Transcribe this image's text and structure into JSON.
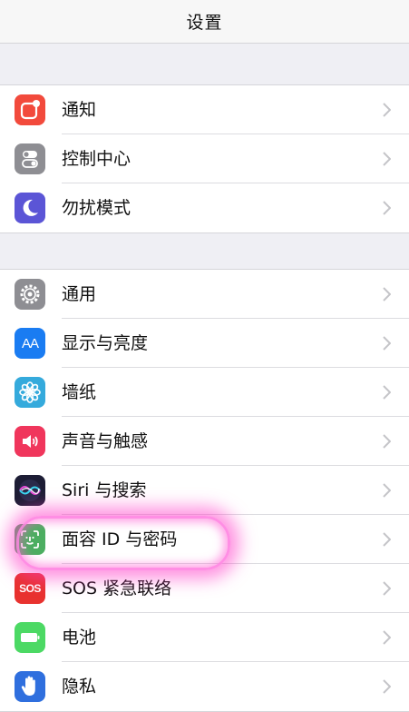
{
  "header": {
    "title": "设置"
  },
  "colors": {
    "notifications": "#f24a3c",
    "control_center": "#8e8e93",
    "do_not_disturb": "#5b55d6",
    "general": "#8e8e93",
    "display": "#1a7cf2",
    "wallpaper": "#35aadc",
    "sounds": "#f0365c",
    "siri": "#1d1d35",
    "face_id": "#4cae61",
    "sos": "#e8322f",
    "battery": "#4cd964",
    "privacy": "#2f6fde",
    "highlight": "#ff3cc8"
  },
  "group1": {
    "items": [
      {
        "label": "通知",
        "icon": "notifications-icon"
      },
      {
        "label": "控制中心",
        "icon": "control-center-icon"
      },
      {
        "label": "勿扰模式",
        "icon": "moon-icon"
      }
    ]
  },
  "group2": {
    "items": [
      {
        "label": "通用",
        "icon": "gear-icon"
      },
      {
        "label": "显示与亮度",
        "icon": "text-size-icon",
        "icon_text": "AA"
      },
      {
        "label": "墙纸",
        "icon": "flower-icon"
      },
      {
        "label": "声音与触感",
        "icon": "speaker-icon"
      },
      {
        "label": "Siri 与搜索",
        "icon": "siri-icon"
      },
      {
        "label": "面容 ID 与密码",
        "icon": "face-id-icon"
      },
      {
        "label": "SOS 紧急联络",
        "icon": "sos-icon",
        "icon_text": "SOS"
      },
      {
        "label": "电池",
        "icon": "battery-icon"
      },
      {
        "label": "隐私",
        "icon": "hand-icon"
      }
    ]
  }
}
